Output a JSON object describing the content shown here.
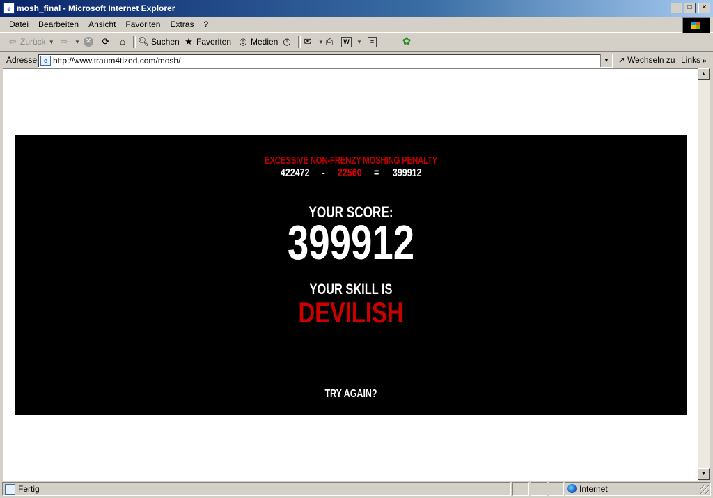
{
  "window": {
    "title": "mosh_final - Microsoft Internet Explorer"
  },
  "menu": [
    {
      "label": "Datei"
    },
    {
      "label": "Bearbeiten"
    },
    {
      "label": "Ansicht"
    },
    {
      "label": "Favoriten"
    },
    {
      "label": "Extras"
    },
    {
      "label": "?"
    }
  ],
  "toolbar": {
    "back": "Zurück",
    "search": "Suchen",
    "favorites": "Favoriten",
    "media": "Medien"
  },
  "address": {
    "label": "Adresse",
    "url": "http://www.traum4tized.com/mosh/",
    "go": "Wechseln zu",
    "links": "Links"
  },
  "game": {
    "penalty_title": "EXCESSIVE NON-FRENZY MOSHING PENALTY",
    "raw_score": "422472",
    "minus": "-",
    "penalty": "22560",
    "equals": "=",
    "net_score": "399912",
    "score_label": "YOUR SCORE:",
    "score": "399912",
    "skill_label": "YOUR SKILL IS",
    "skill": "DEVILISH",
    "try_again": "TRY AGAIN?"
  },
  "status": {
    "text": "Fertig",
    "zone": "Internet"
  }
}
